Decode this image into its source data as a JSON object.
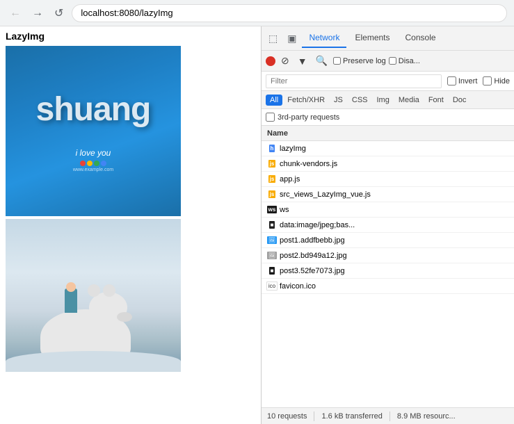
{
  "browser": {
    "back_label": "←",
    "forward_label": "→",
    "reload_label": "↺",
    "address": "localhost:8080/lazyImg"
  },
  "page": {
    "title": "LazyImg",
    "img1_text": "shuang",
    "img1_love": "i love you"
  },
  "devtools": {
    "tabs": [
      "Elements Picker",
      "Device Mode",
      "Network",
      "Elements",
      "Console"
    ],
    "active_tab": "Network",
    "toolbar": {
      "record_title": "Record",
      "stop_title": "Stop",
      "filter_title": "Filter",
      "search_title": "Search",
      "preserve_log_label": "Preserve log",
      "disable_cache_label": "Disa..."
    },
    "filter": {
      "placeholder": "Filter",
      "invert_label": "Invert",
      "hide_label": "Hide"
    },
    "type_filters": [
      "All",
      "Fetch/XHR",
      "JS",
      "CSS",
      "Img",
      "Media",
      "Font",
      "Doc"
    ],
    "active_type": "All",
    "third_party_label": "3rd-party requests",
    "column_header": "Name",
    "rows": [
      {
        "name": "lazyImg",
        "icon": "html"
      },
      {
        "name": "chunk-vendors.js",
        "icon": "js"
      },
      {
        "name": "app.js",
        "icon": "js"
      },
      {
        "name": "src_views_LazyImg_vue.js",
        "icon": "js"
      },
      {
        "name": "ws",
        "icon": "ws"
      },
      {
        "name": "data:image/jpeg;bas...",
        "icon": "data"
      },
      {
        "name": "post1.addfbebb.jpg",
        "icon": "img"
      },
      {
        "name": "post2.bd949a12.jpg",
        "icon": "img-gray"
      },
      {
        "name": "post3.52fe7073.jpg",
        "icon": "img-dark"
      },
      {
        "name": "favicon.ico",
        "icon": "fav"
      }
    ],
    "status": {
      "requests": "10 requests",
      "transferred": "1.6 kB transferred",
      "resources": "8.9 MB resourc..."
    }
  }
}
